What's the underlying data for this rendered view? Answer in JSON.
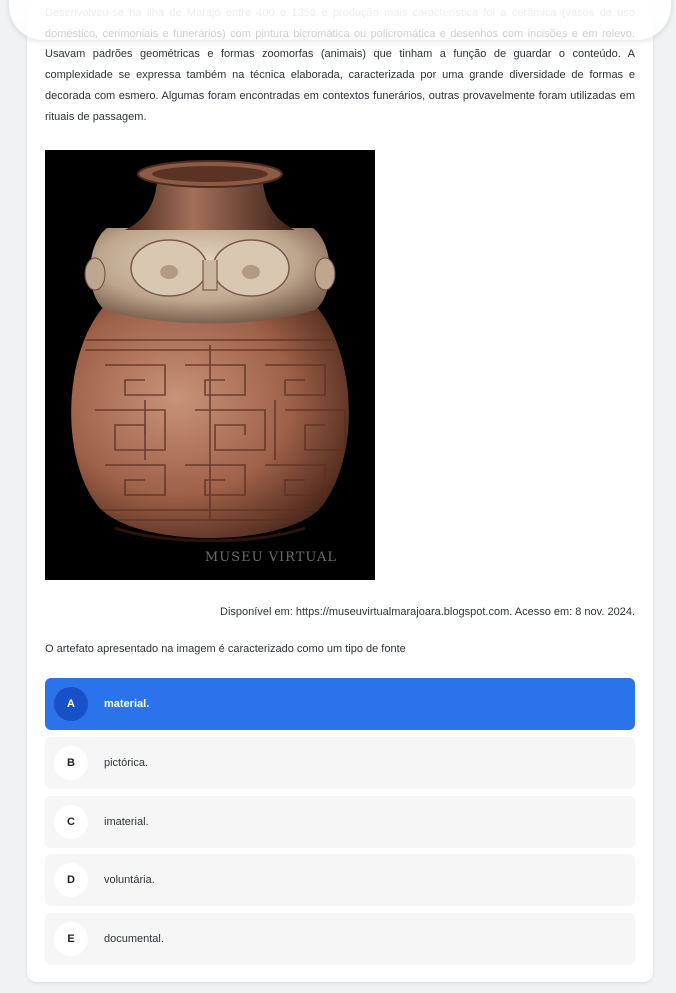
{
  "passage": {
    "lines": [
      "Desenvolveu-se na ilha de Marajó entre 400 e 1350 e produção mais característica foi a cerâmica (vasos de uso",
      "doméstico, cerimoniais e funerários) com pintura bicromática ou policromática e desenhos com incisões e em",
      "relevo. Usavam padrões geométricas e formas zoomorfas (animais) que tinham a função de guardar o conteúdo.",
      "A complexidade se expressa também na técnica elaborada, caracterizada por uma grande diversidade de formas",
      "e decorada com esmero. Algumas foram encontradas em contextos funerários, outras provavelmente foram",
      "utilizadas em rituais de passagem."
    ]
  },
  "image": {
    "watermark": "MUSEU VIRTUAL"
  },
  "source": "Disponível em: https://museuvirtualmarajoara.blogspot.com. Acesso em: 8 nov. 2024.",
  "question": "O artefato apresentado na imagem é caracterizado como um tipo de fonte",
  "options": [
    {
      "letter": "A",
      "text": "material.",
      "selected": true
    },
    {
      "letter": "B",
      "text": "pictórica.",
      "selected": false
    },
    {
      "letter": "C",
      "text": "imaterial.",
      "selected": false
    },
    {
      "letter": "D",
      "text": "voluntária.",
      "selected": false
    },
    {
      "letter": "E",
      "text": "documental.",
      "selected": false
    }
  ],
  "colors": {
    "selected_option": "#2b73ea",
    "selected_letter_bg": "#1850c8",
    "option_bg": "#f6f6f7",
    "page_bg": "#f1f2f4"
  }
}
